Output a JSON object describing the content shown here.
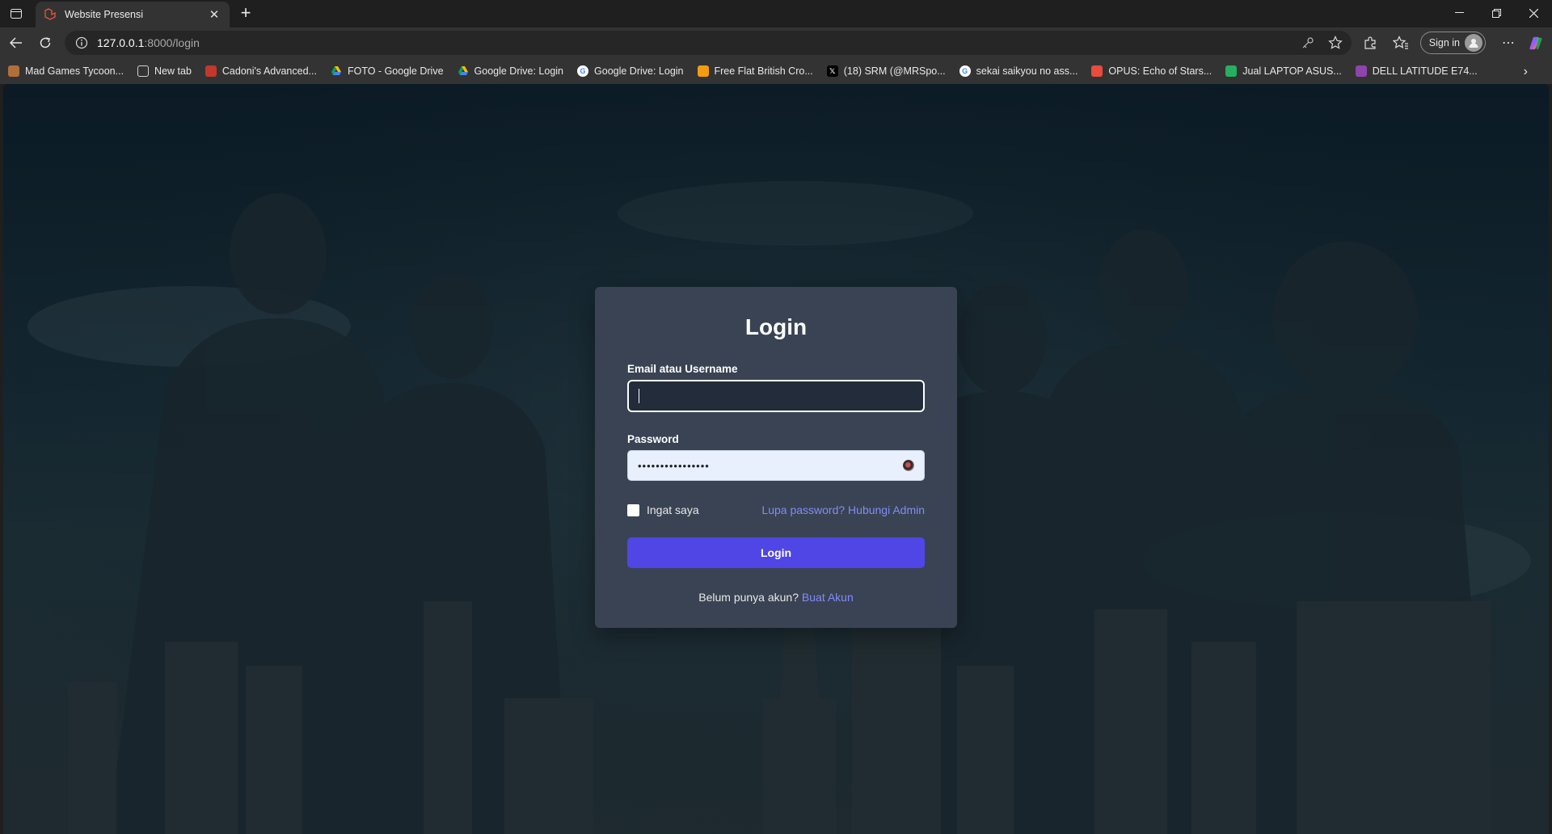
{
  "browser": {
    "tab_title": "Website Presensi",
    "url_host": "127.0.0.1",
    "url_path": ":8000/login",
    "sign_in_label": "Sign in",
    "bookmarks": [
      {
        "label": "Mad Games Tycoon...",
        "icon": "game-icon",
        "color": "#b0703a"
      },
      {
        "label": "New tab",
        "icon": "new-tab-icon",
        "color": "#5a5a5a"
      },
      {
        "label": "Cadoni's Advanced...",
        "icon": "site-icon",
        "color": "#c0392b"
      },
      {
        "label": "FOTO - Google Drive",
        "icon": "google-drive-icon",
        "color": "#34a853"
      },
      {
        "label": "Google Drive: Login",
        "icon": "google-drive-icon",
        "color": "#34a853"
      },
      {
        "label": "Google Drive: Login",
        "icon": "google-icon",
        "color": "#4285f4"
      },
      {
        "label": "Free Flat British Cro...",
        "icon": "site-icon",
        "color": "#f39c12"
      },
      {
        "label": "(18) SRM (@MRSpo...",
        "icon": "x-icon",
        "color": "#000000"
      },
      {
        "label": "sekai saikyou no ass...",
        "icon": "google-icon",
        "color": "#4285f4"
      },
      {
        "label": "OPUS: Echo of Stars...",
        "icon": "site-icon",
        "color": "#e74c3c"
      },
      {
        "label": "Jual LAPTOP ASUS...",
        "icon": "site-icon",
        "color": "#27ae60"
      },
      {
        "label": "DELL LATITUDE E74...",
        "icon": "site-icon",
        "color": "#8e44ad"
      }
    ]
  },
  "login": {
    "title": "Login",
    "email_label": "Email atau Username",
    "email_value": "",
    "password_label": "Password",
    "password_value": "••••••••••••••••",
    "remember_label": "Ingat saya",
    "forgot_label": "Lupa password? Hubungi Admin",
    "button_label": "Login",
    "signup_prompt": "Belum punya akun?",
    "signup_link": "Buat Akun"
  },
  "colors": {
    "accent": "#4f46e5",
    "link": "#818cf8",
    "card": "#394353"
  }
}
